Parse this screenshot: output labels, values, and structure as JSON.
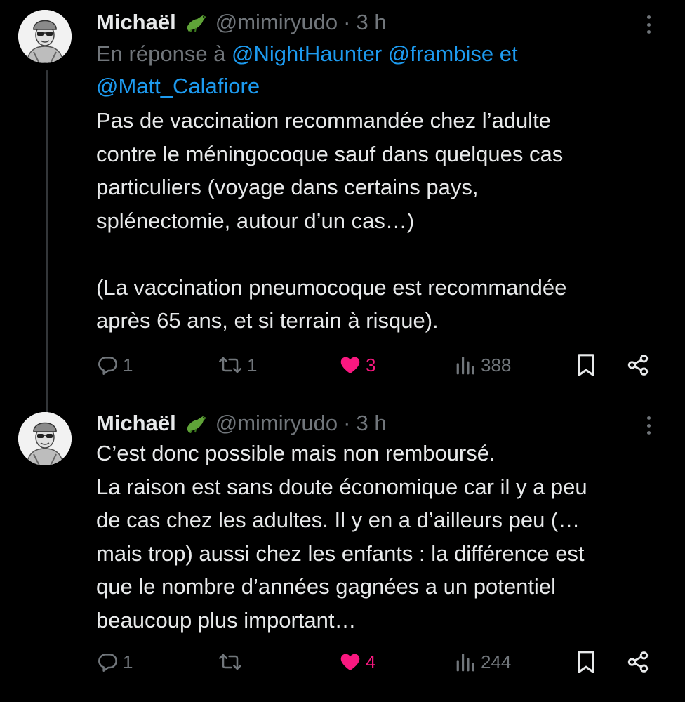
{
  "tweets": [
    {
      "author": {
        "name": "Michaël",
        "emoji_icon": "crocodile-icon",
        "handle": "@mimiryudo",
        "separator": "·",
        "time": "3 h"
      },
      "reply_to": {
        "prefix": "En réponse à ",
        "mentions": [
          "@NightHaunter",
          "@frambise"
        ],
        "joiner": "et",
        "last_mention": "@Matt_Calafiore"
      },
      "body": {
        "paragraph1": [
          "Pas de vaccination recommandée chez l’adulte",
          "contre le méningocoque sauf dans quelques cas",
          "particuliers (voyage dans certains pays,",
          "splénectomie, autour d’un cas…)"
        ],
        "paragraph2": [
          "(La vaccination pneumocoque est recommandée",
          "après 65 ans, et si terrain à risque)."
        ]
      },
      "actions": {
        "replies": "1",
        "retweets": "1",
        "likes": "3",
        "views": "388"
      }
    },
    {
      "author": {
        "name": "Michaël",
        "emoji_icon": "crocodile-icon",
        "handle": "@mimiryudo",
        "separator": "·",
        "time": "3 h"
      },
      "body": {
        "lines": [
          "C’est donc possible mais non remboursé.",
          "La raison est sans doute économique car il y a peu",
          "de cas chez les adultes. Il y en a d’ailleurs peu (…",
          "mais trop) aussi chez les enfants : la différence est",
          "que le nombre d’années gagnées a un potentiel",
          "beaucoup plus important…"
        ]
      },
      "actions": {
        "replies": "1",
        "retweets": "",
        "likes": "4",
        "views": "244"
      }
    }
  ],
  "colors": {
    "background": "#000000",
    "text": "#e7e9ea",
    "muted": "#71767b",
    "link": "#1d9bf0",
    "like": "#f91880"
  }
}
